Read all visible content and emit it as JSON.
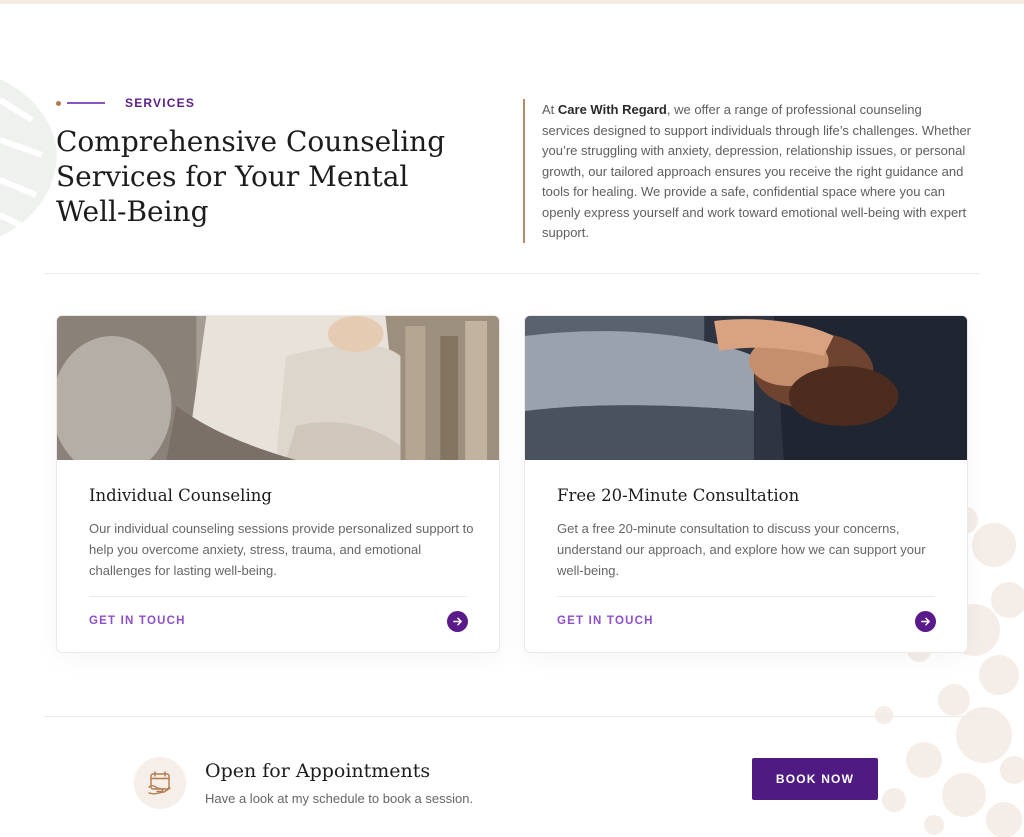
{
  "header": {
    "eyebrow": "SERVICES",
    "headline": "Comprehensive Counseling Services for Your Mental Well-Being",
    "intro_prefix": "At ",
    "intro_brand": "Care With Regard",
    "intro_rest": ", we offer a range of professional counseling services designed to support individuals through life’s challenges. Whether you’re struggling with anxiety, depression, relationship issues, or personal growth, our tailored approach ensures you receive the right guidance and tools for healing. We provide a safe, confidential space where you can openly express yourself and work toward emotional well-being with expert support."
  },
  "cards": [
    {
      "title": "Individual Counseling",
      "description": "Our individual counseling sessions provide personalized support to help you overcome anxiety, stress, trauma, and emotional challenges for lasting well-being.",
      "cta": "GET IN TOUCH",
      "icon": "arrow-right-icon"
    },
    {
      "title": "Free 20-Minute Consultation",
      "description": "Get a free 20-minute consultation to discuss your concerns, understand our approach, and explore how we can support your well-being.",
      "cta": "GET IN TOUCH",
      "icon": "arrow-right-icon"
    }
  ],
  "appointment": {
    "icon": "calendar-hand-icon",
    "title": "Open for Appointments",
    "subtitle": "Have a look at my schedule to book a session.",
    "button": "BOOK NOW"
  },
  "colors": {
    "brand_purple": "#4f1a82",
    "accent_purple": "#8f4fc8",
    "accent_brown": "#b58a68",
    "icon_bg": "#f6eee8"
  }
}
